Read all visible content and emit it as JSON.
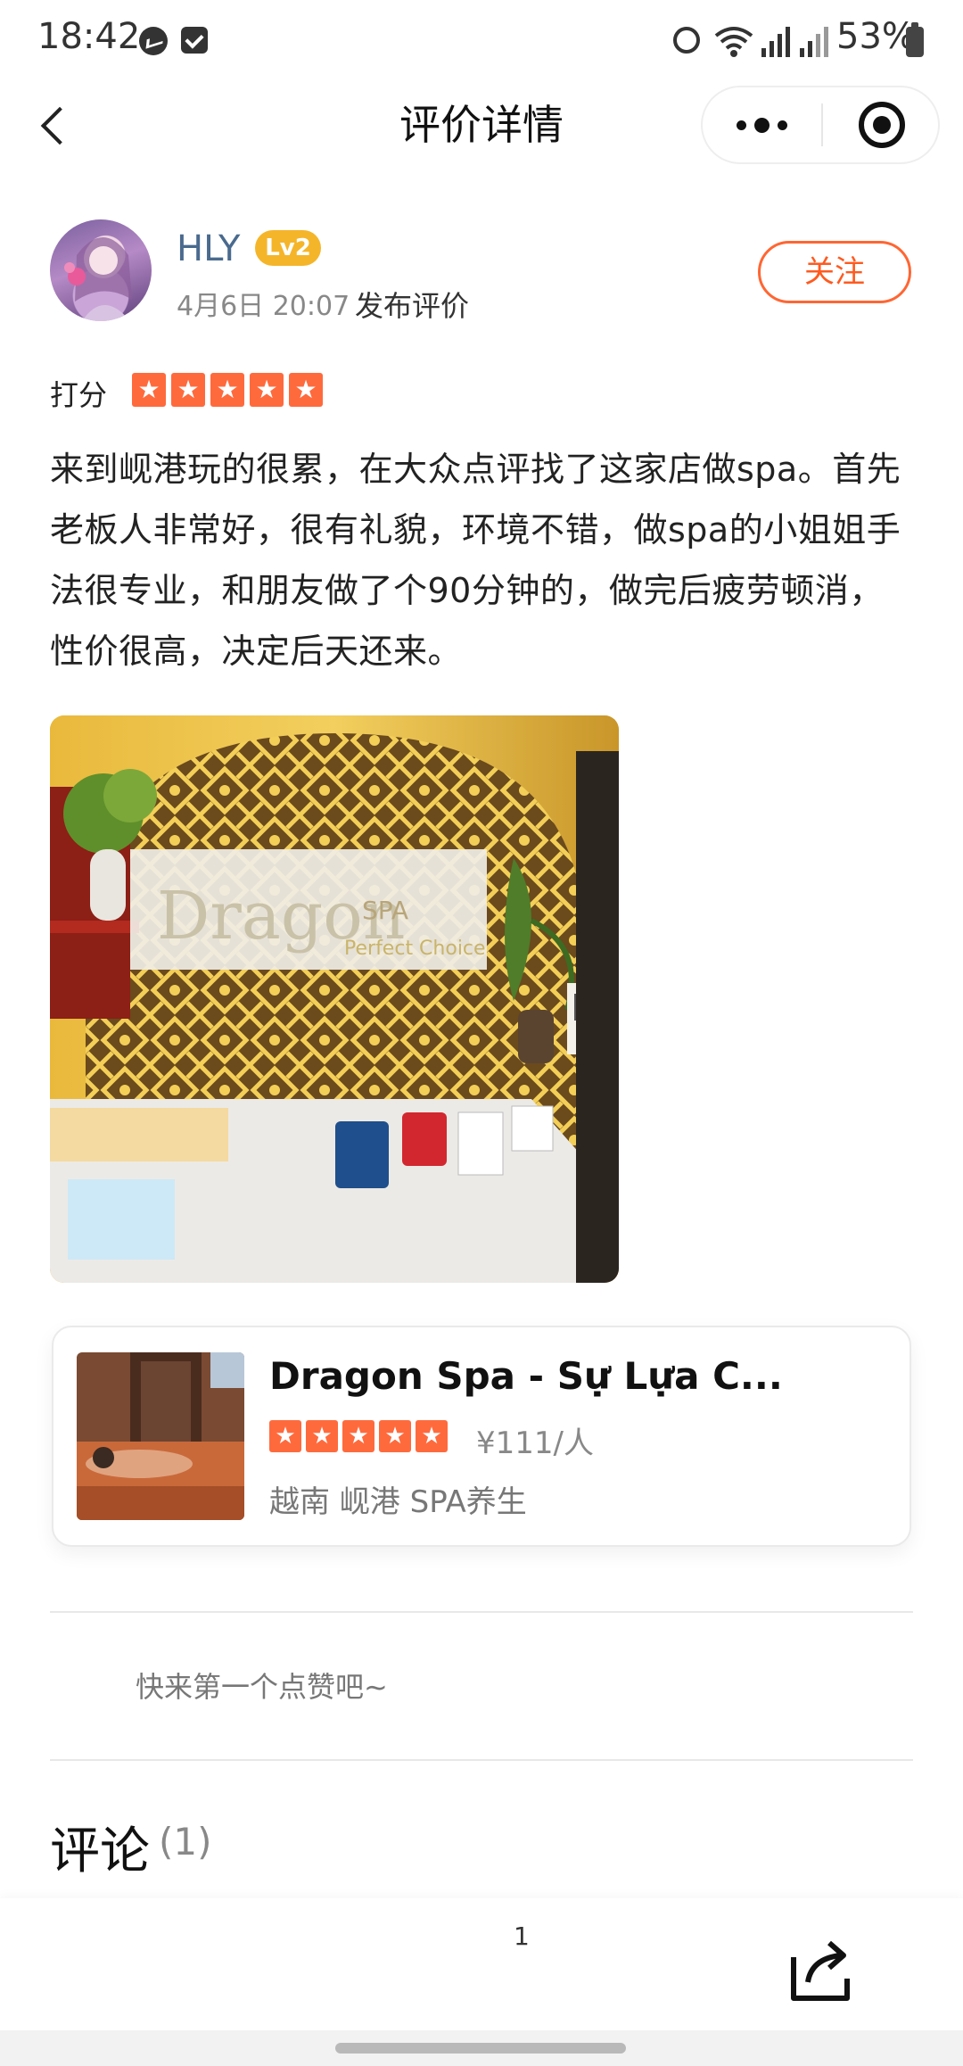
{
  "status_bar": {
    "time": "18:42",
    "battery": "53%"
  },
  "header": {
    "title": "评价详情"
  },
  "user": {
    "name": "HLY",
    "level": "Lv2",
    "post_time": "4月6日 20:07",
    "post_action": "发布评价",
    "follow_label": "关注"
  },
  "rating": {
    "label": "打分",
    "stars": 5,
    "star_color": "#ff6a3d"
  },
  "review": {
    "text": "来到岘港玩的很累，在大众点评找了这家店做spa。首先老板人非常好，很有礼貌，环境不错，做spa的小姐姐手法很专业，和朋友做了个90分钟的，做完后疲劳顿消，性价很高，决定后天还来。"
  },
  "shop": {
    "name": "Dragon Spa - Sự Lựa C...",
    "stars": 5,
    "price": "¥111/人",
    "location": "越南 岘港 SPA养生"
  },
  "likes": {
    "hint": "快来第一个点赞吧~"
  },
  "comments": {
    "title": "评论",
    "count": "(1)"
  },
  "bottom_bar": {
    "count": "1"
  },
  "colors": {
    "accent": "#ff5a1f",
    "level_badge": "#f5b52a",
    "username": "#4a6a8e"
  }
}
